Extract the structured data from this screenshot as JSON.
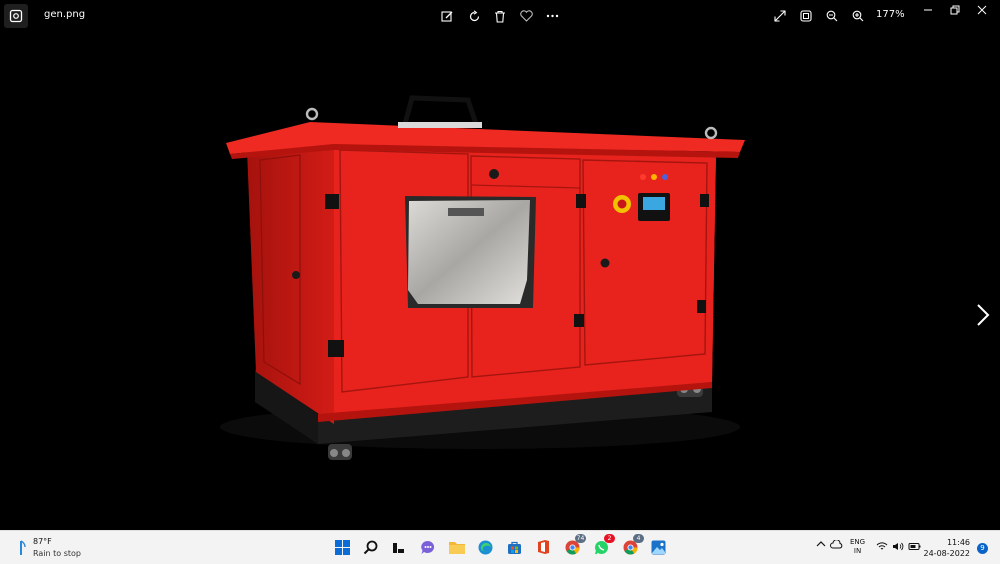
{
  "titlebar": {
    "file_name": "gen.png",
    "zoom_level": "177%",
    "icons": [
      "photos-app-icon",
      "edit-icon",
      "rotate-icon",
      "delete-icon",
      "favorite-icon",
      "more-icon",
      "fullscreen-icon",
      "fit-icon",
      "zoom-out-icon",
      "zoom-in-icon",
      "minimize-icon",
      "restore-icon",
      "close-icon"
    ]
  },
  "viewer": {
    "next_icon": "chevron-right-icon",
    "image_subject": "red-generator",
    "colors": {
      "body": "#e8231d",
      "dark": "#1a1a1a",
      "steel": "#b9b7b3"
    }
  },
  "taskbar": {
    "weather": {
      "temp": "87°F",
      "desc": "Rain to stop"
    },
    "apps": [
      "start",
      "search",
      "task-view",
      "chat",
      "file-explorer",
      "edge",
      "store",
      "office",
      "chrome",
      "whatsapp",
      "chrome-profile",
      "photos"
    ],
    "badges": {
      "chrome": "74",
      "whatsapp": "2",
      "chrome_profile": "4"
    },
    "tray": {
      "lang_1": "ENG",
      "lang_2": "IN"
    },
    "clock": {
      "time": "11:46",
      "date": "24-08-2022"
    },
    "notification_count": "9"
  }
}
